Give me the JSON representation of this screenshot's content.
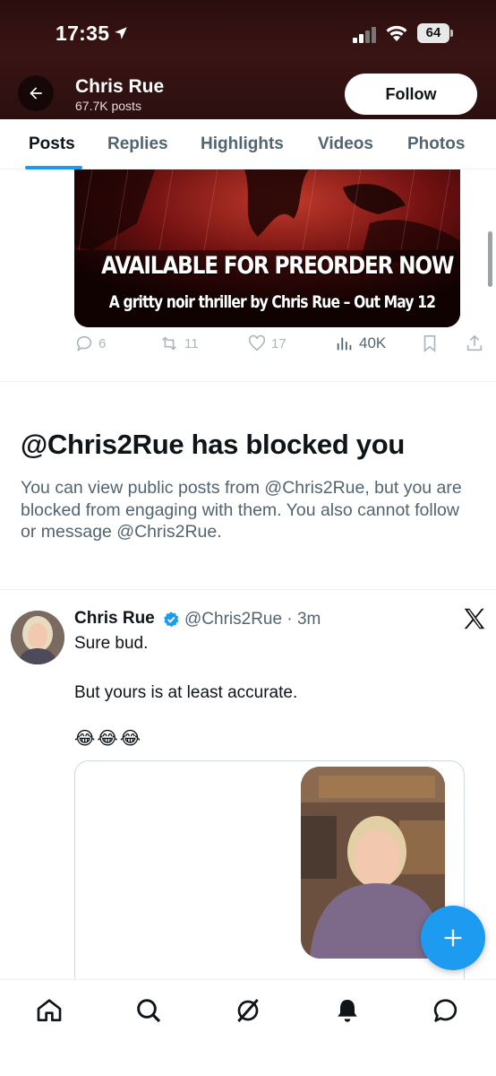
{
  "status_bar": {
    "time": "17:35",
    "battery": "64",
    "location_icon": "location-arrow-icon",
    "signal_icon": "cellular-signal-icon",
    "wifi_icon": "wifi-icon"
  },
  "header": {
    "name": "Chris Rue",
    "post_count": "67.7K posts",
    "follow_label": "Follow",
    "back_icon": "back-arrow-icon"
  },
  "tabs": [
    {
      "label": "Posts",
      "active": true
    },
    {
      "label": "Replies"
    },
    {
      "label": "Highlights"
    },
    {
      "label": "Videos"
    },
    {
      "label": "Photos"
    }
  ],
  "media_post": {
    "headline": "AVAILABLE FOR PREORDER NOW",
    "subline": "A gritty noir thriller by Chris Rue – Out May 12",
    "replies": "6",
    "reposts": "11",
    "likes": "17",
    "views": "40K"
  },
  "blocked": {
    "title": "@Chris2Rue has blocked you",
    "message": "You can view public posts from @Chris2Rue, but you are blocked from engaging with them. You also cannot follow or message @Chris2Rue."
  },
  "post": {
    "name": "Chris Rue",
    "handle": "@Chris2Rue",
    "time": "3m",
    "line1": "Sure bud.",
    "line2": "But yours is at least accurate.",
    "emoji": "😂😂😂"
  },
  "bottom_nav": [
    "home-icon",
    "search-icon",
    "grok-icon",
    "notifications-icon",
    "messages-icon"
  ],
  "colors": {
    "accent": "#1d9bf0",
    "header_bg": "#2a0d0d",
    "secondary_text": "#536471"
  }
}
